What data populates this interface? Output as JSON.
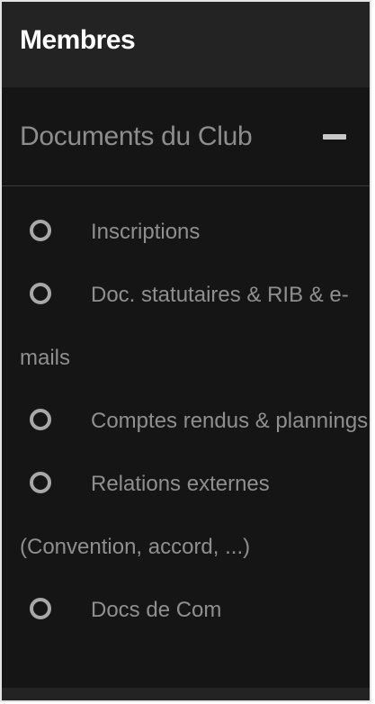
{
  "header": {
    "title": "Membres"
  },
  "section": {
    "title": "Documents du Club",
    "toggle_icon": "minus-icon",
    "items": [
      {
        "label": "Inscriptions",
        "icon": "circle-icon"
      },
      {
        "label": "Doc. statutaires & RIB & e-mails",
        "icon": "circle-icon"
      },
      {
        "label": "Comptes rendus & plannings",
        "icon": "circle-icon"
      },
      {
        "label": "Relations externes (Convention, accord, ...)",
        "icon": "circle-icon"
      },
      {
        "label": "Docs de Com",
        "icon": "circle-icon"
      }
    ]
  },
  "colors": {
    "background": "#151515",
    "header_bg": "#232323",
    "title_text": "#ffffff",
    "muted_text": "#8f8f8f"
  }
}
